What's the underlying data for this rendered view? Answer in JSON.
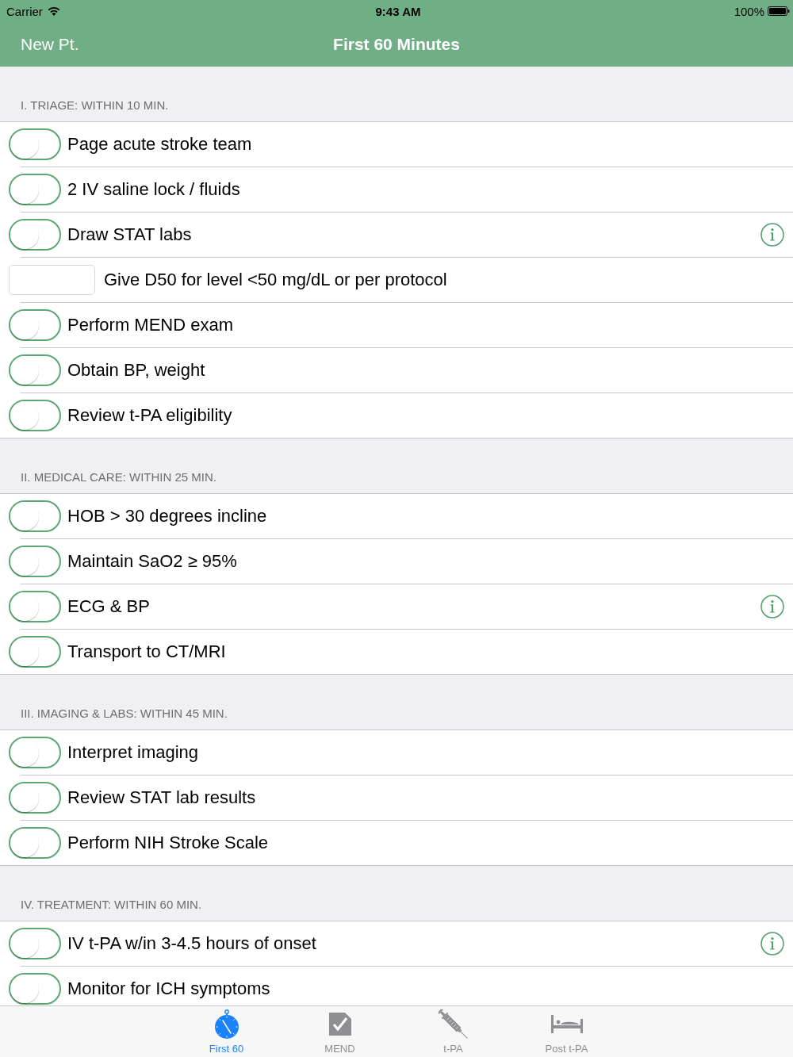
{
  "status_bar": {
    "carrier": "Carrier",
    "time": "9:43 AM",
    "battery": "100%"
  },
  "nav_bar": {
    "left_button": "New Pt.",
    "title": "First 60 Minutes"
  },
  "sections": [
    {
      "header": "I. TRIAGE: WITHIN 10 MIN.",
      "items": [
        {
          "kind": "toggle",
          "label": "Page acute stroke team",
          "on": false,
          "info": false
        },
        {
          "kind": "toggle",
          "label": "2 IV saline lock / fluids",
          "on": false,
          "info": false
        },
        {
          "kind": "toggle",
          "label": "Draw STAT labs",
          "on": false,
          "info": true
        },
        {
          "kind": "field",
          "label": "Give D50 for level <50 mg/dL or per protocol",
          "info": false
        },
        {
          "kind": "toggle",
          "label": "Perform MEND exam",
          "on": false,
          "info": false
        },
        {
          "kind": "toggle",
          "label": "Obtain BP, weight",
          "on": false,
          "info": false
        },
        {
          "kind": "toggle",
          "label": "Review t-PA eligibility",
          "on": false,
          "info": false
        }
      ]
    },
    {
      "header": "II. MEDICAL CARE: WITHIN 25 MIN.",
      "items": [
        {
          "kind": "toggle",
          "label": "HOB > 30 degrees incline",
          "on": false,
          "info": false
        },
        {
          "kind": "toggle",
          "label": "Maintain SaO2 ≥ 95%",
          "on": false,
          "info": false
        },
        {
          "kind": "toggle",
          "label": "ECG & BP",
          "on": false,
          "info": true
        },
        {
          "kind": "toggle",
          "label": "Transport to CT/MRI",
          "on": false,
          "info": false
        }
      ]
    },
    {
      "header": "III. IMAGING & LABS: WITHIN 45 MIN.",
      "items": [
        {
          "kind": "toggle",
          "label": "Interpret imaging",
          "on": false,
          "info": false
        },
        {
          "kind": "toggle",
          "label": "Review STAT lab results",
          "on": false,
          "info": false
        },
        {
          "kind": "toggle",
          "label": "Perform NIH Stroke Scale",
          "on": false,
          "info": false
        }
      ]
    },
    {
      "header": "IV. TREATMENT: WITHIN 60 MIN.",
      "items": [
        {
          "kind": "toggle",
          "label": "IV t-PA w/in 3-4.5 hours of onset",
          "on": false,
          "info": true
        },
        {
          "kind": "toggle",
          "label": "Monitor for ICH symptoms",
          "on": false,
          "info": false
        }
      ]
    }
  ],
  "tab_bar": {
    "tabs": [
      {
        "label": "First 60",
        "selected": true
      },
      {
        "label": "MEND",
        "selected": false
      },
      {
        "label": "t-PA",
        "selected": false
      },
      {
        "label": "Post t-PA",
        "selected": false
      }
    ]
  }
}
